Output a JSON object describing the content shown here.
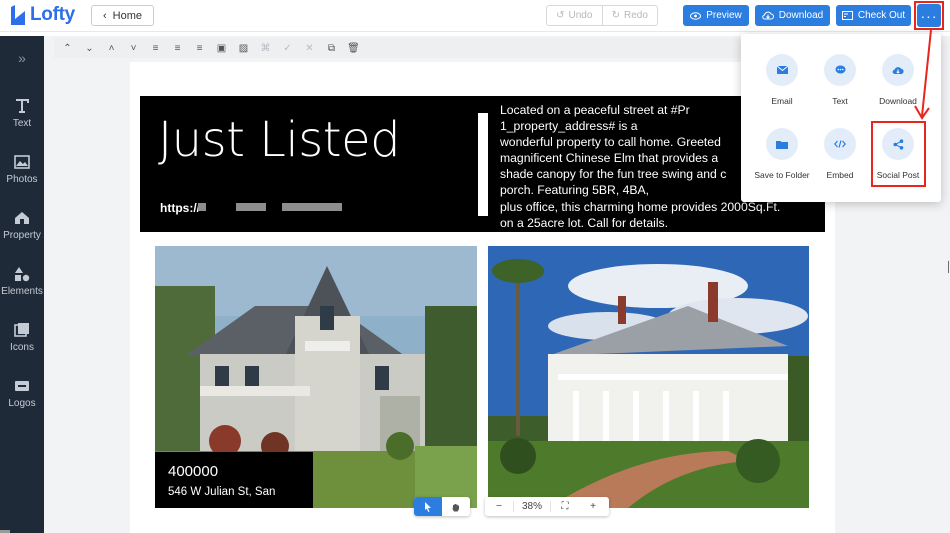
{
  "app": {
    "logo_text": "Lofty"
  },
  "header": {
    "home_label": "Home",
    "undo_label": "Undo",
    "redo_label": "Redo",
    "preview_label": "Preview",
    "download_label": "Download",
    "checkout_label": "Check Out",
    "more_label": "···"
  },
  "sidebar": {
    "items": [
      {
        "label": "Text",
        "icon": "text-icon"
      },
      {
        "label": "Photos",
        "icon": "image-icon"
      },
      {
        "label": "Property",
        "icon": "house-icon"
      },
      {
        "label": "Elements",
        "icon": "shapes-icon"
      },
      {
        "label": "Icons",
        "icon": "icons-icon"
      },
      {
        "label": "Logos",
        "icon": "logo-badge-icon"
      }
    ]
  },
  "flyer": {
    "title": "Just Listed",
    "url_prefix": "https://",
    "description": "Located on a peaceful street at #Pr\n1_property_address# is a\nwonderful property to call home. Greeted\nmagnificent Chinese Elm that provides a\nshade canopy for the fun tree swing and c\nporch. Featuring 5BR, 4BA,\nplus office, this charming home provides 2000Sq.Ft.\non a 25acre lot. Call for details.",
    "price": "400000",
    "address": "546 W Julian St, San"
  },
  "zoom": {
    "value": "38%"
  },
  "share_menu": {
    "items": [
      {
        "label": "Email",
        "icon": "email-icon"
      },
      {
        "label": "Text",
        "icon": "chat-icon"
      },
      {
        "label": "Download",
        "icon": "cloud-download-icon"
      },
      {
        "label": "Save to Folder",
        "icon": "folder-icon"
      },
      {
        "label": "Embed",
        "icon": "code-icon"
      },
      {
        "label": "Social Post",
        "icon": "share-icon"
      }
    ]
  },
  "colors": {
    "accent": "#2b7de0",
    "sidebar_bg": "#1f2a38",
    "highlight": "#e8261b"
  }
}
